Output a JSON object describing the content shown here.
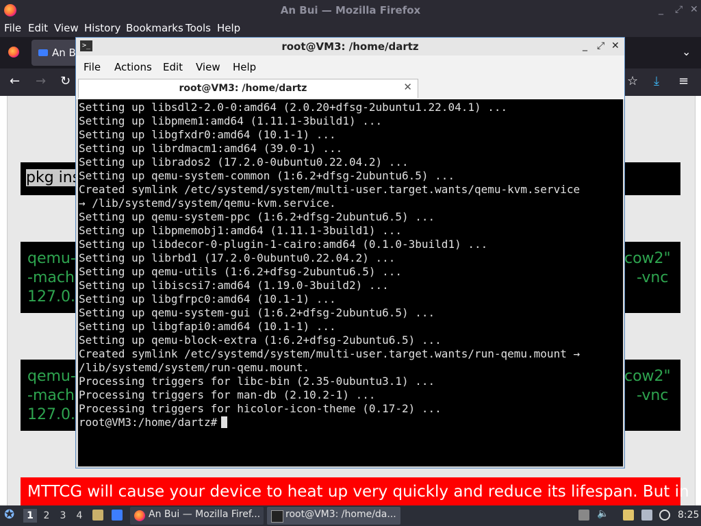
{
  "firefox": {
    "title": "An Bui — Mozilla Firefox",
    "menu": [
      "File",
      "Edit",
      "View",
      "History",
      "Bookmarks",
      "Tools",
      "Help"
    ],
    "tab_label": "An Bu"
  },
  "page": {
    "block1": "pkg ins",
    "block2": [
      "qemu-",
      "-mach",
      "127.0."
    ],
    "block2_right": [
      "cow2\"",
      "-vnc"
    ],
    "block3": [
      "qemu-",
      "-mach",
      "127.0."
    ],
    "block3_right": [
      "cow2\"",
      "-vnc"
    ],
    "red_banner": "MTTCG will cause your device to heat up very quickly and reduce its lifespan. But in"
  },
  "terminal": {
    "title": "root@VM3: /home/dartz",
    "menu": [
      "File",
      "Actions",
      "Edit",
      "View",
      "Help"
    ],
    "tab_label": "root@VM3: /home/dartz",
    "lines": [
      "Setting up libsdl2-2.0-0:amd64 (2.0.20+dfsg-2ubuntu1.22.04.1) ...",
      "Setting up libpmem1:amd64 (1.11.1-3build1) ...",
      "Setting up libgfxdr0:amd64 (10.1-1) ...",
      "Setting up librdmacm1:amd64 (39.0-1) ...",
      "Setting up librados2 (17.2.0-0ubuntu0.22.04.2) ...",
      "Setting up qemu-system-common (1:6.2+dfsg-2ubuntu6.5) ...",
      "Created symlink /etc/systemd/system/multi-user.target.wants/qemu-kvm.service",
      "→ /lib/systemd/system/qemu-kvm.service.",
      "Setting up qemu-system-ppc (1:6.2+dfsg-2ubuntu6.5) ...",
      "Setting up libpmemobj1:amd64 (1.11.1-3build1) ...",
      "Setting up libdecor-0-plugin-1-cairo:amd64 (0.1.0-3build1) ...",
      "Setting up librbd1 (17.2.0-0ubuntu0.22.04.2) ...",
      "Setting up qemu-utils (1:6.2+dfsg-2ubuntu6.5) ...",
      "Setting up libiscsi7:amd64 (1.19.0-3build2) ...",
      "Setting up libgfrpc0:amd64 (10.1-1) ...",
      "Setting up qemu-system-gui (1:6.2+dfsg-2ubuntu6.5) ...",
      "Setting up libgfapi0:amd64 (10.1-1) ...",
      "Setting up qemu-block-extra (1:6.2+dfsg-2ubuntu6.5) ...",
      "Created symlink /etc/systemd/system/multi-user.target.wants/run-qemu.mount →",
      "/lib/systemd/system/run-qemu.mount.",
      "Processing triggers for libc-bin (2.35-0ubuntu3.1) ...",
      "Processing triggers for man-db (2.10.2-1) ...",
      "Processing triggers for hicolor-icon-theme (0.17-2) ..."
    ],
    "prompt": "root@VM3:/home/dartz#"
  },
  "taskbar": {
    "workspaces": [
      "1",
      "2",
      "3",
      "4"
    ],
    "windows": [
      "An Bui — Mozilla Firef...",
      "root@VM3: /home/da..."
    ],
    "clock": "8:25"
  }
}
